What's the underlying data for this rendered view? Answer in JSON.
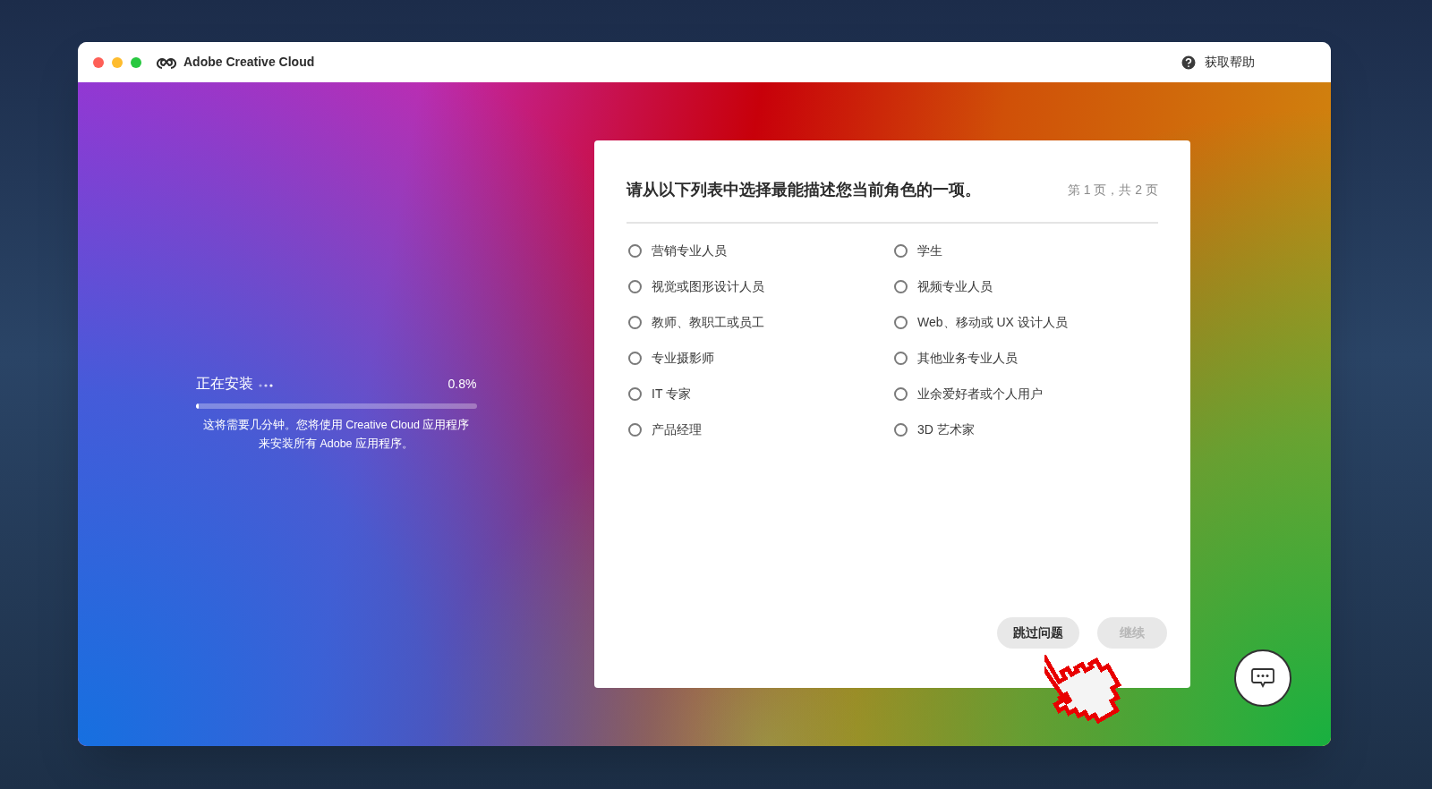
{
  "window": {
    "title": "Adobe Creative Cloud",
    "help": "获取帮助"
  },
  "install": {
    "label": "正在安装",
    "percent": "0.8%",
    "level": 0.008,
    "note": "这将需要几分钟。您将使用 Creative Cloud 应用程序来安装所有 Adobe 应用程序。"
  },
  "survey": {
    "question": "请从以下列表中选择最能描述您当前角色的一项。",
    "page": "第 1 页，共 2 页",
    "options": [
      {
        "label": "营销专业人员",
        "selected": false
      },
      {
        "label": "学生",
        "selected": false
      },
      {
        "label": "视觉或图形设计人员",
        "selected": false
      },
      {
        "label": "视频专业人员",
        "selected": false
      },
      {
        "label": "教师、教职工或员工",
        "selected": false
      },
      {
        "label": "Web、移动或 UX 设计人员",
        "selected": false
      },
      {
        "label": "专业摄影师",
        "selected": false
      },
      {
        "label": "其他业务专业人员",
        "selected": false
      },
      {
        "label": "IT 专家",
        "selected": false
      },
      {
        "label": "业余爱好者或个人用户",
        "selected": false
      },
      {
        "label": "产品经理",
        "selected": false
      },
      {
        "label": "3D 艺术家",
        "selected": false
      }
    ],
    "buttons": [
      {
        "label": "跳过问题",
        "disabled": false
      },
      {
        "label": "继续",
        "disabled": true
      }
    ]
  }
}
